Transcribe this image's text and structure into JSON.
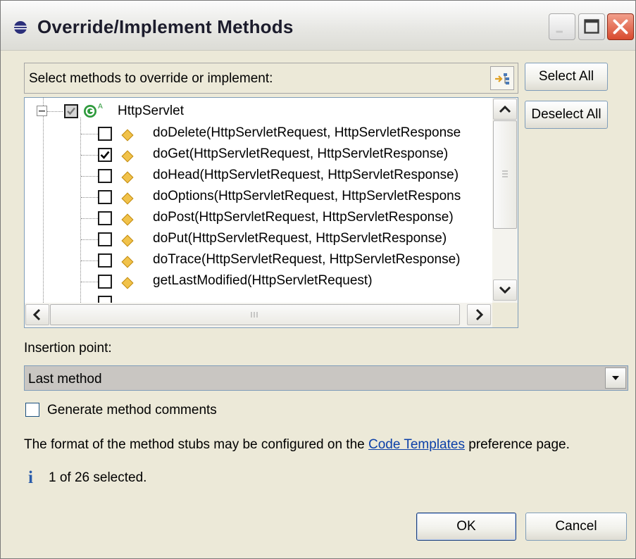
{
  "window": {
    "title": "Override/Implement Methods"
  },
  "methods": {
    "header_label": "Select methods to override or implement:",
    "select_all": "Select All",
    "deselect_all": "Deselect All",
    "root": {
      "label": "HttpServlet",
      "checked": "partial",
      "badge": "A"
    },
    "items": [
      {
        "label": "doDelete(HttpServletRequest, HttpServletResponse",
        "checked": false
      },
      {
        "label": "doGet(HttpServletRequest, HttpServletResponse)",
        "checked": true
      },
      {
        "label": "doHead(HttpServletRequest, HttpServletResponse)",
        "checked": false
      },
      {
        "label": "doOptions(HttpServletRequest, HttpServletRespons",
        "checked": false
      },
      {
        "label": "doPost(HttpServletRequest, HttpServletResponse)",
        "checked": false
      },
      {
        "label": "doPut(HttpServletRequest, HttpServletResponse)",
        "checked": false
      },
      {
        "label": "doTrace(HttpServletRequest, HttpServletResponse)",
        "checked": false
      },
      {
        "label": "getLastModified(HttpServletRequest)",
        "checked": false
      }
    ]
  },
  "insertion": {
    "label": "Insertion point:",
    "value": "Last method"
  },
  "comments": {
    "label": "Generate method comments",
    "checked": false
  },
  "format_note": {
    "before": "The format of the method stubs may be configured on the ",
    "link": "Code Templates",
    "after": " preference page."
  },
  "status": {
    "text": "1 of 26 selected."
  },
  "buttons": {
    "ok": "OK",
    "cancel": "Cancel"
  },
  "colors": {
    "link": "#0b3fa8",
    "close_button": "#d84a2e",
    "method_icon": "#f1c24a",
    "class_icon": "#2e9a3c"
  }
}
